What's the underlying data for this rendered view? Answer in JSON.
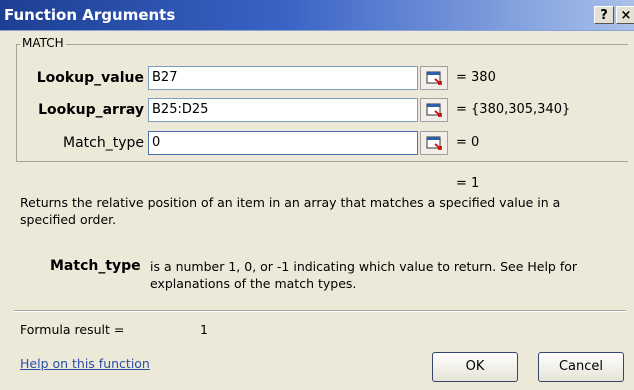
{
  "window": {
    "title": "Function Arguments",
    "help_button": "?",
    "close_button": "×"
  },
  "function_group": {
    "legend": "MATCH",
    "args": [
      {
        "label": "Lookup_value",
        "value": "B27",
        "evaluated": "= 380"
      },
      {
        "label": "Lookup_array",
        "value": "B25:D25",
        "evaluated": "= {380,305,340}"
      },
      {
        "label": "Match_type",
        "value": "0",
        "evaluated": "= 0"
      }
    ]
  },
  "overall_result": "= 1",
  "description": "Returns the relative position of an item in an array that matches a specified value in a specified order.",
  "arg_help": {
    "name": "Match_type",
    "text": "is a number 1, 0, or -1 indicating which value to return. See Help for explanations of the match types."
  },
  "formula_result": {
    "label": "Formula result =",
    "value": "1"
  },
  "help_link": "Help on this function",
  "buttons": {
    "ok": "OK",
    "cancel": "Cancel"
  }
}
